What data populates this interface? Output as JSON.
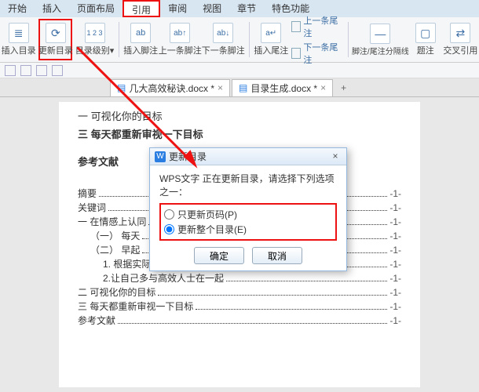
{
  "menubar": {
    "tabs": [
      "开始",
      "插入",
      "页面布局",
      "引用",
      "审阅",
      "视图",
      "章节",
      "特色功能"
    ],
    "active_index": 3
  },
  "ribbon": {
    "items": [
      {
        "label": "插入目录",
        "icon": "≣"
      },
      {
        "label": "更新目录",
        "icon": "⟳",
        "highlight": true
      },
      {
        "label": "目录级别",
        "icon": "1 2 3",
        "dropdown": true
      }
    ],
    "footnote_group": [
      {
        "label": "插入脚注",
        "icon": "ab"
      },
      {
        "label": "上一条脚注",
        "icon": "ab↑"
      },
      {
        "label": "下一条脚注",
        "icon": "ab↓"
      }
    ],
    "endnote_group": {
      "button": "插入尾注",
      "rows": [
        "上一条尾注",
        "下一条尾注"
      ]
    },
    "right": [
      "脚注/尾注分隔线",
      "题注",
      "交叉引用"
    ]
  },
  "tabbar": {
    "tabs": [
      {
        "label": "几大高效秘诀.docx *"
      },
      {
        "label": "目录生成.docx *"
      }
    ],
    "plus": "+"
  },
  "document": {
    "lines_top": [
      "一  可视化你的目标",
      "三  每天都重新审视一下目标",
      "参考文献"
    ],
    "toc": [
      {
        "text": "摘要",
        "page": "1",
        "indent": 0
      },
      {
        "text": "关键词",
        "page": "1",
        "indent": 0
      },
      {
        "text": "一 在情感上认同",
        "page": "1",
        "indent": 0
      },
      {
        "text": "（一） 每天",
        "page": "1",
        "indent": 1
      },
      {
        "text": "（二） 早起",
        "page": "1",
        "indent": 1
      },
      {
        "text": "1. 根据实际工作为身体补充能量",
        "page": "1",
        "indent": 2
      },
      {
        "text": "2.让自己多与高效人士在一起",
        "page": "1",
        "indent": 2
      },
      {
        "text": "二 可视化你的目标",
        "page": "1",
        "indent": 0
      },
      {
        "text": "三 每天都重新审视一下目标",
        "page": "1",
        "indent": 0
      },
      {
        "text": "参考文献",
        "page": "1",
        "indent": 0
      }
    ]
  },
  "dialog": {
    "title": "更新目录",
    "prompt": "WPS文字 正在更新目录，请选择下列选项之一：",
    "options": [
      {
        "label": "只更新页码(P)",
        "value": "pages"
      },
      {
        "label": "更新整个目录(E)",
        "value": "all",
        "checked": true
      }
    ],
    "ok": "确定",
    "cancel": "取消"
  }
}
